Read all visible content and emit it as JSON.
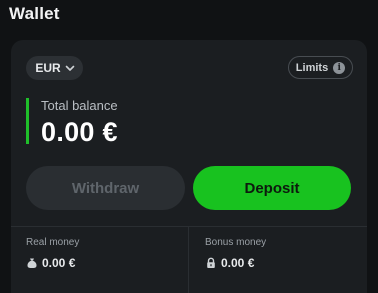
{
  "header": {
    "title": "Wallet"
  },
  "wallet": {
    "currency": "EUR",
    "limits_label": "Limits",
    "info_glyph": "i",
    "total_balance_label": "Total balance",
    "total_balance_value": "0.00 €",
    "withdraw_label": "Withdraw",
    "deposit_label": "Deposit",
    "real_money": {
      "label": "Real money",
      "value": "0.00 €",
      "icon": "money-bag-icon"
    },
    "bonus_money": {
      "label": "Bonus money",
      "value": "0.00 €",
      "icon": "lock-icon"
    }
  },
  "colors": {
    "accent_green": "#18c21f",
    "balance_bar": "#1fbf2a",
    "background": "#101214",
    "card": "#1b1e21"
  }
}
